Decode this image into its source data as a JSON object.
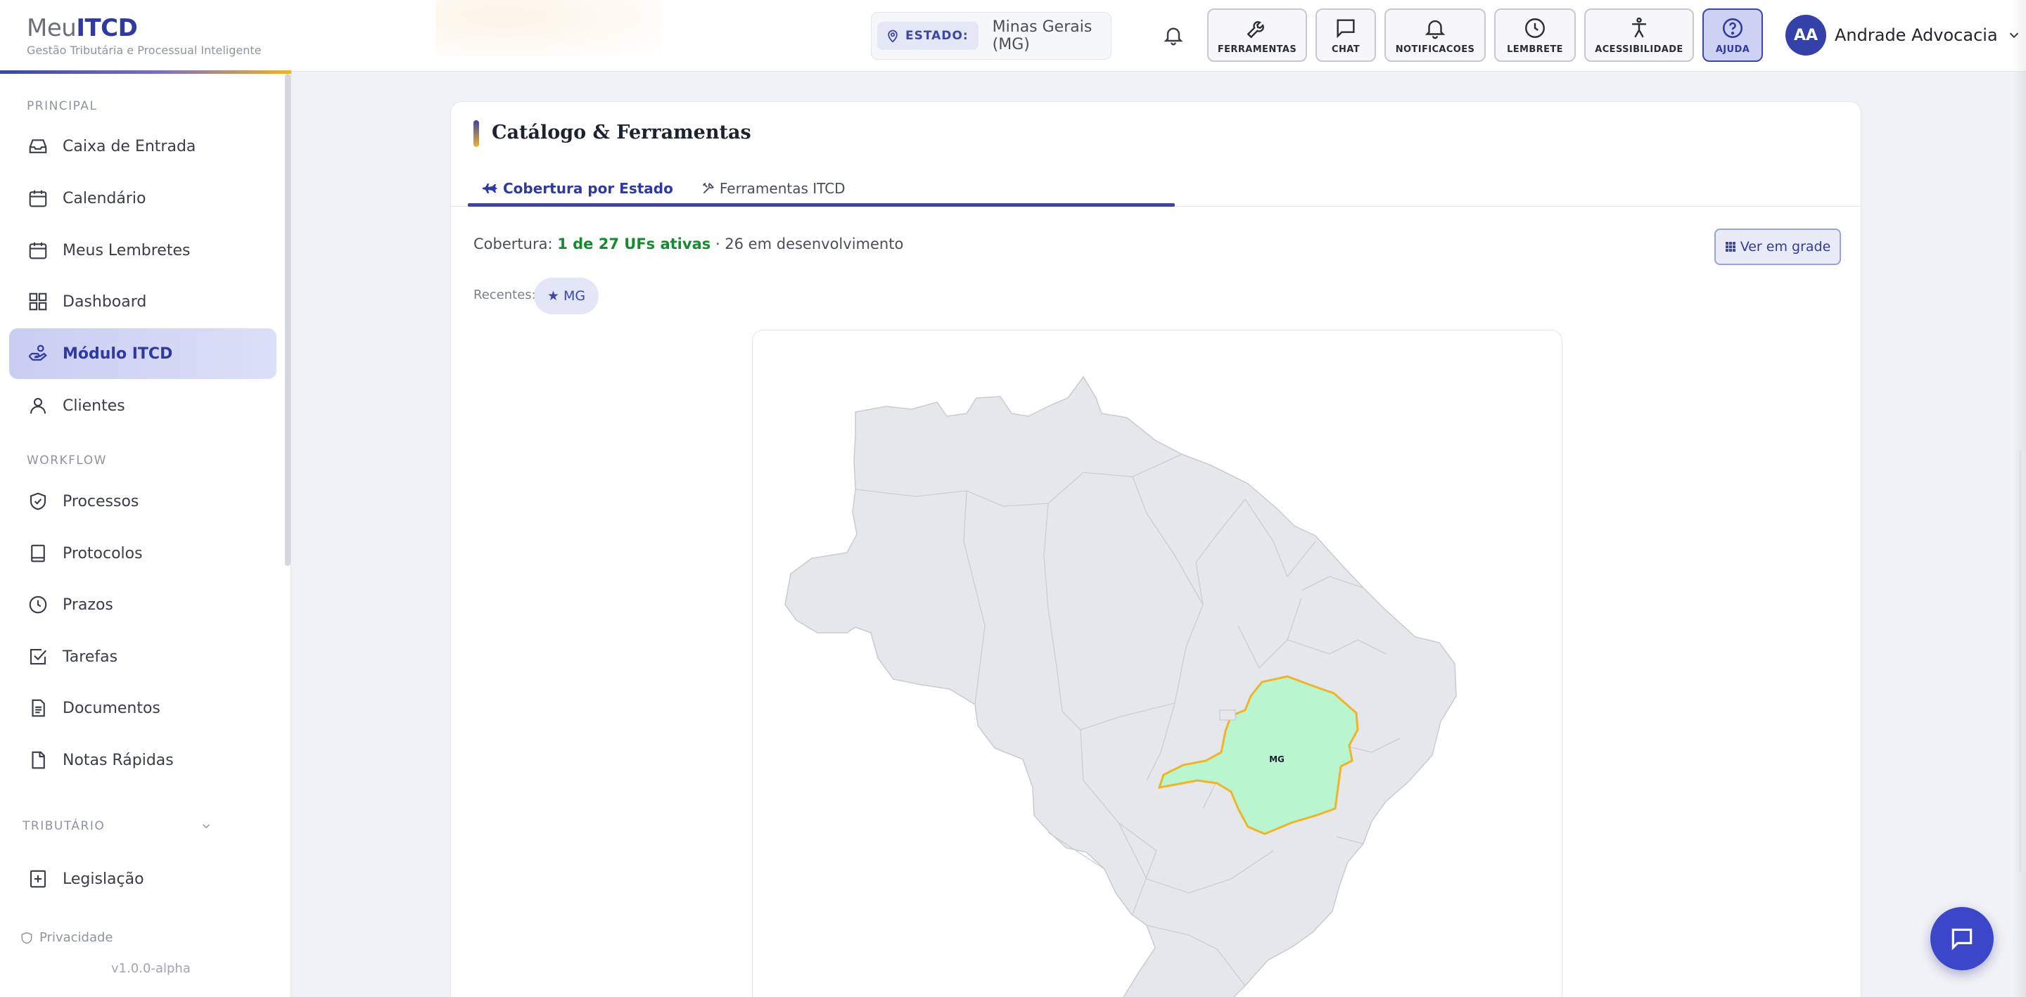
{
  "app": {
    "logo_prefix": "Meu",
    "logo_strong": "ITCD",
    "logo_subtitle": "Gestão Tributária e Processual Inteligente"
  },
  "header": {
    "estado_label": "ESTADO:",
    "estado_value": "Minas Gerais (MG)",
    "tools": [
      {
        "label": "FERRAMENTAS",
        "icon": "wrench-icon"
      },
      {
        "label": "CHAT",
        "icon": "chat-icon"
      },
      {
        "label": "NOTIFICACOES",
        "icon": "bell-icon"
      },
      {
        "label": "LEMBRETE",
        "icon": "clock-icon"
      },
      {
        "label": "ACESSIBILIDADE",
        "icon": "accessibility-icon"
      },
      {
        "label": "AJUDA",
        "icon": "help-icon",
        "active": true
      }
    ],
    "user_initials": "AA",
    "user_name": "Andrade Advocacia"
  },
  "sidebar": {
    "sections": {
      "principal": "PRINCIPAL",
      "workflow": "WORKFLOW",
      "tributario": "TRIBUTÁRIO"
    },
    "items": [
      {
        "label": "Caixa de Entrada",
        "icon": "inbox-icon"
      },
      {
        "label": "Calendário",
        "icon": "calendar-icon"
      },
      {
        "label": "Meus Lembretes",
        "icon": "calendar-icon"
      },
      {
        "label": "Dashboard",
        "icon": "grid-icon"
      },
      {
        "label": "Módulo ITCD",
        "icon": "hand-coin-icon",
        "active": true
      },
      {
        "label": "Clientes",
        "icon": "user-icon"
      },
      {
        "label": "Processos",
        "icon": "shield-check-icon"
      },
      {
        "label": "Protocolos",
        "icon": "book-icon"
      },
      {
        "label": "Prazos",
        "icon": "clock-icon"
      },
      {
        "label": "Tarefas",
        "icon": "checkbox-icon"
      },
      {
        "label": "Documentos",
        "icon": "document-icon"
      },
      {
        "label": "Notas Rápidas",
        "icon": "note-icon"
      },
      {
        "label": "Legislação",
        "icon": "plus-box-icon"
      }
    ],
    "privacy": "Privacidade",
    "version": "v1.0.0-alpha"
  },
  "card": {
    "title": "Catálogo & Ferramentas",
    "tabs": [
      {
        "label": "Cobertura por Estado",
        "icon": "airplane-icon",
        "active": true
      },
      {
        "label": "Ferramentas ITCD",
        "icon": "tools-icon"
      }
    ],
    "coverage_prefix": "Cobertura:",
    "coverage_active": "1 de 27 UFs ativas",
    "coverage_rest": "· 26 em desenvolvimento",
    "grid_button": "Ver em grade",
    "recent_label": "Recentes:",
    "recent_chip": "★ MG",
    "map_highlight_label": "MG"
  },
  "colors": {
    "brand": "#3b46a8",
    "accent": "#f0b429",
    "active_state_fill": "#b9f5cf",
    "active_state_stroke": "#f0b429",
    "inactive_state_fill": "#e6e7eb",
    "ok_text": "#168a2e"
  }
}
